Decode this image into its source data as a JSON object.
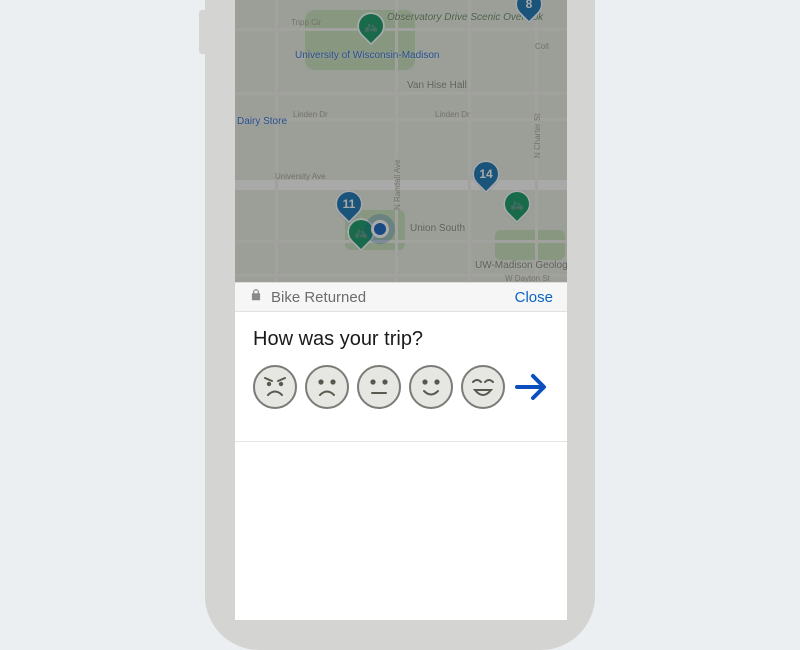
{
  "modal": {
    "status_text": "Bike Returned",
    "close_label": "Close"
  },
  "rating": {
    "prompt": "How was your trip?",
    "faces": [
      "angry",
      "sad",
      "neutral",
      "happy",
      "very-happy"
    ]
  },
  "map": {
    "labels": {
      "uw_madison": "University of\nWisconsin-Madison",
      "observatory": "Observatory\nDrive Scenic\nOverlook",
      "union_south": "Union South",
      "van_hise": "Van Hise Hall",
      "geology": "UW-Madison\nGeology Museum",
      "dairy_store": "Dairy Store"
    },
    "streets": {
      "linden": "Linden Dr",
      "linden2": "Linden Dr",
      "dayton": "W Dayton St",
      "univ": "University Ave",
      "charter": "N Charter St",
      "randall": "N Randall Ave",
      "coll": "Coll",
      "observatory": "Observatory Dr",
      "tripp": "Tripp Cir"
    },
    "stations": [
      {
        "count": "8",
        "kind": "count"
      },
      {
        "count": "14",
        "kind": "count"
      },
      {
        "count": "11",
        "kind": "count"
      },
      {
        "count": "",
        "kind": "bike"
      },
      {
        "count": "",
        "kind": "bike"
      },
      {
        "count": "",
        "kind": "bike"
      },
      {
        "count": "",
        "kind": "empty"
      }
    ]
  },
  "colors": {
    "pin_blue": "#1976b3",
    "pin_green": "#149b67",
    "accent_link": "#0b63c4",
    "arrow": "#0b4fbf"
  }
}
